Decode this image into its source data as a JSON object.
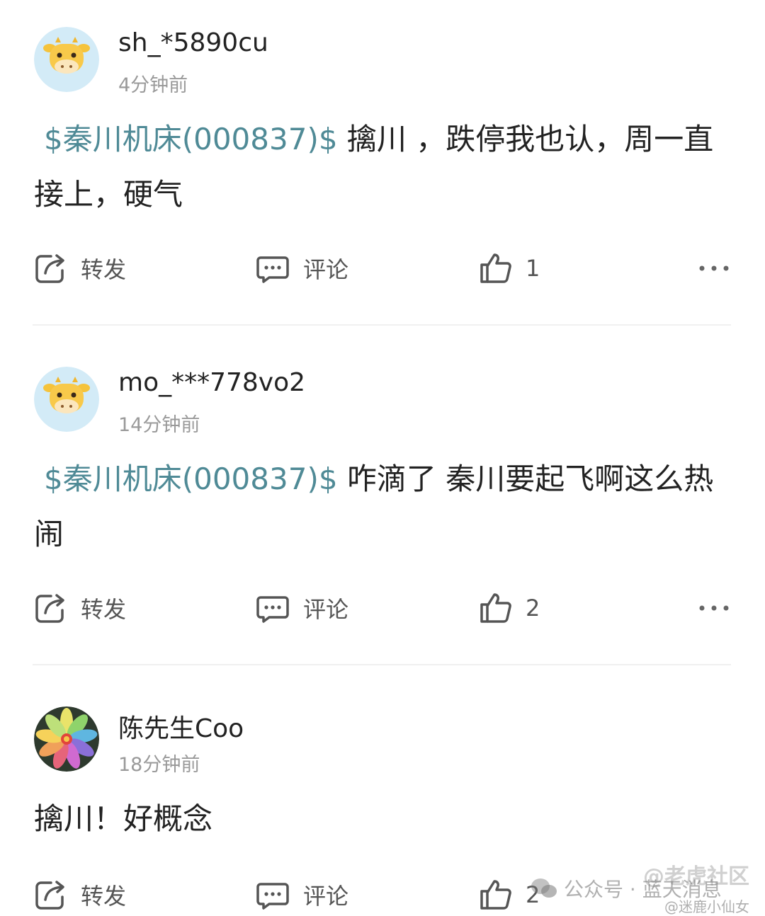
{
  "posts": [
    {
      "username": "sh_*5890cu",
      "time": "4分钟前",
      "stock_tag": "$秦川机床(000837)$",
      "text": " 擒川 ，跌停我也认，周一直接上，硬气",
      "share_label": "转发",
      "comment_label": "评论",
      "like_count": "1",
      "avatar_icon": "cow-avatar-icon"
    },
    {
      "username": "mo_***778vo2",
      "time": "14分钟前",
      "stock_tag": "$秦川机床(000837)$",
      "text": " 咋滴了 秦川要起飞啊这么热闹",
      "share_label": "转发",
      "comment_label": "评论",
      "like_count": "2",
      "avatar_icon": "cow-avatar-icon"
    },
    {
      "username": "陈先生Coo",
      "time": "18分钟前",
      "stock_tag": "",
      "text": "擒川！好概念",
      "share_label": "转发",
      "comment_label": "评论",
      "like_count": "2",
      "avatar_icon": "flower-avatar-icon"
    }
  ],
  "watermark": {
    "line1": "@老虎社区",
    "line2": "公众号 · 蓝天消息",
    "line3": "@迷鹿小仙女"
  },
  "colors": {
    "stock_tag": "#4f8a96",
    "text": "#222222",
    "muted": "#9a9a9a",
    "icon": "#555555"
  }
}
